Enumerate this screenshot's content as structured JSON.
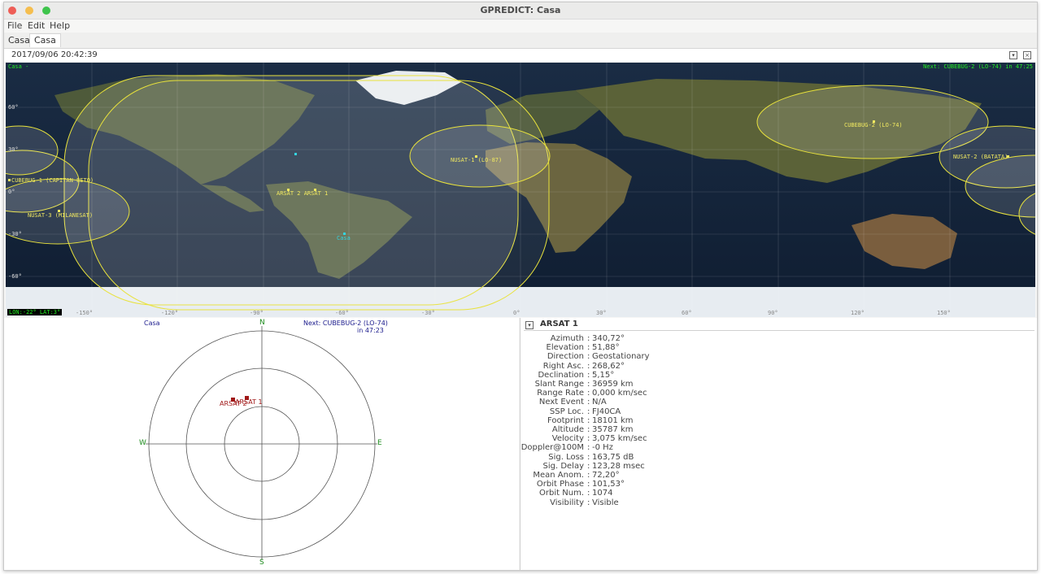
{
  "window": {
    "title": "GPREDICT: Casa",
    "colors": {
      "close": "#ee5e57",
      "minimize": "#f5be4f",
      "maximize": "#3ec44c"
    }
  },
  "menu": [
    {
      "label": "File"
    },
    {
      "label": "Edit"
    },
    {
      "label": "Help"
    }
  ],
  "tabs": [
    {
      "label": "Casa"
    },
    {
      "label": "Casa"
    }
  ],
  "header": {
    "datetime": "2017/09/06 20:42:39"
  },
  "map": {
    "qth_label": "Casa -",
    "next_event": "Next: CUBEBUG-2 (LO-74)  in 47:25",
    "cursor_readout": "LON:-22° LAT:3°",
    "lat_labels": [
      "60°",
      "30°",
      "0°",
      "-30°",
      "-60°"
    ],
    "lon_labels": [
      "-150°",
      "-120°",
      "-90°",
      "-60°",
      "-30°",
      "0°",
      "30°",
      "60°",
      "90°",
      "120°",
      "150°"
    ],
    "satellites": [
      {
        "name": "CUBEBUG-1 (CAPITAN BETO)"
      },
      {
        "name": "NUSAT-3 (MILANESAT)"
      },
      {
        "name": "ARSAT 2 ARSAT 1"
      },
      {
        "name": "NUSAT-1 (LO-87)"
      },
      {
        "name": "CUBEBUG-2 (LO-74)"
      },
      {
        "name": "NUSAT-2 (BATATA)"
      }
    ],
    "ground_station": "Casa",
    "colors": {
      "footprint": "#e8e23c",
      "sat_label": "#f0e860",
      "station": "#34d4e0",
      "text": "#22ee22"
    }
  },
  "polar": {
    "qth_label": "Casa",
    "next_line1": "Next: CUBEBUG-2 (LO-74)",
    "next_line2": "in 47:23",
    "north": "N",
    "south": "S",
    "east": "E",
    "west": "W",
    "sat_labels": [
      "ARSAT 2",
      "ARSAT 1"
    ],
    "colors": {
      "sat": "#a01818",
      "compass": "#1e8c1e",
      "text": "#1a1a8c"
    }
  },
  "info": {
    "title": "ARSAT 1",
    "rows": [
      {
        "label": "Azimuth",
        "value": "340,72°"
      },
      {
        "label": "Elevation",
        "value": "51,88°"
      },
      {
        "label": "Direction",
        "value": "Geostationary"
      },
      {
        "label": "Right Asc.",
        "value": "268,62°"
      },
      {
        "label": "Declination",
        "value": "5,15°"
      },
      {
        "label": "Slant Range",
        "value": "36959 km"
      },
      {
        "label": "Range Rate",
        "value": "0,000 km/sec"
      },
      {
        "label": "Next Event",
        "value": "N/A"
      },
      {
        "label": "SSP Loc.",
        "value": "FJ40CA"
      },
      {
        "label": "Footprint",
        "value": "18101 km"
      },
      {
        "label": "Altitude",
        "value": "35787 km"
      },
      {
        "label": "Velocity",
        "value": "3,075 km/sec"
      },
      {
        "label": "Doppler@100M",
        "value": "-0 Hz"
      },
      {
        "label": "Sig. Loss",
        "value": "163,75 dB"
      },
      {
        "label": "Sig. Delay",
        "value": "123,28 msec"
      },
      {
        "label": "Mean Anom.",
        "value": "72,20°"
      },
      {
        "label": "Orbit Phase",
        "value": "101,53°"
      },
      {
        "label": "Orbit Num.",
        "value": "1074"
      },
      {
        "label": "Visibility",
        "value": "Visible"
      }
    ]
  }
}
